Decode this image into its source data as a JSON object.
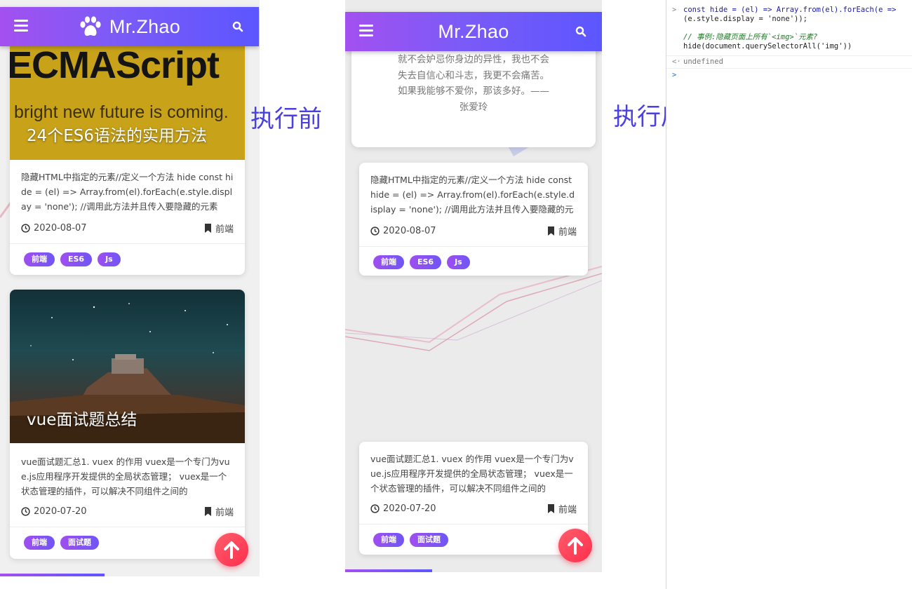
{
  "captions": {
    "before": "执行前",
    "after": "执行后"
  },
  "header": {
    "brand": "Mr.Zhao"
  },
  "before": {
    "cards": [
      {
        "cover_big_text": "ECMAScript",
        "cover_sub_text": "bright new future is coming.",
        "cover_title": "24个ES6语法的实用方法",
        "excerpt": "隐藏HTML中指定的元素//定义一个方法 hide const hide = (el) => Array.from(el).forEach(e.style.display = 'none'); //调用此方法并且传入要隐藏的元素",
        "date": "2020-08-07",
        "category": "前端",
        "tags": [
          "前端",
          "ES6",
          "Js"
        ]
      },
      {
        "cover_title": "vue面试题总结",
        "excerpt": "vue面试题汇总1. vuex 的作用 vuex是一个专门为vue.js应用程序开发提供的全局状态管理； vuex是一个状态管理的插件，可以解决不同组件之间的",
        "date": "2020-07-20",
        "category": "前端",
        "tags": [
          "前端",
          "面试题"
        ]
      }
    ]
  },
  "after": {
    "quote_lines": [
      "就不会妒忌你身边的异性，我也不会",
      "失去自信心和斗志，我更不会痛苦。",
      "如果我能够不爱你，那该多好。——",
      "张爱玲"
    ],
    "cards": [
      {
        "excerpt": "隐藏HTML中指定的元素//定义一个方法 hide const hide = (el) => Array.from(el).forEach(e.style.display = 'none'); //调用此方法并且传入要隐藏的元素",
        "date": "2020-08-07",
        "category": "前端",
        "tags": [
          "前端",
          "ES6",
          "Js"
        ]
      },
      {
        "excerpt": "vue面试题汇总1. vuex 的作用 vuex是一个专门为vue.js应用程序开发提供的全局状态管理； vuex是一个状态管理的插件，可以解决不同组件之间的",
        "date": "2020-07-20",
        "category": "前端",
        "tags": [
          "前端",
          "面试题"
        ]
      }
    ]
  },
  "console": {
    "line1": "const hide = (el) => Array.from(el).forEach(e =>",
    "line2": "(e.style.display = 'none'));",
    "comment": "// 事例:隐藏页面上所有`<img>`元素?",
    "call": "hide(document.querySelectorAll('img'))",
    "output": "undefined"
  },
  "colors": {
    "accent": "#7b5bf7",
    "fab": "#ff3d57",
    "caption": "#4a3fe0"
  }
}
